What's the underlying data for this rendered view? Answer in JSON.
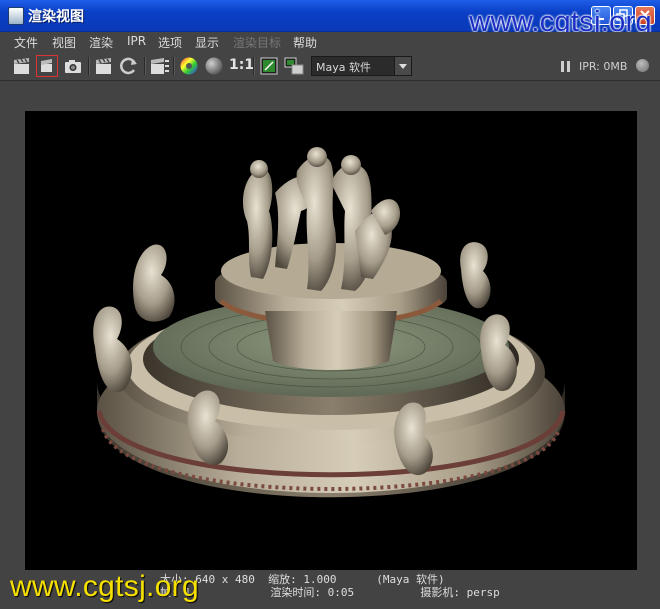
{
  "window": {
    "title": "渲染视图"
  },
  "watermark": "www.cgtsj.org",
  "menus": [
    {
      "label": "文件",
      "disabled": false
    },
    {
      "label": "视图",
      "disabled": false
    },
    {
      "label": "渲染",
      "disabled": false
    },
    {
      "label": "IPR",
      "disabled": false
    },
    {
      "label": "选项",
      "disabled": false
    },
    {
      "label": "显示",
      "disabled": false
    },
    {
      "label": "渲染目标",
      "disabled": true
    },
    {
      "label": "帮助",
      "disabled": false
    }
  ],
  "toolbar": {
    "ratio_label": "1:1",
    "renderer_selected": "Maya 软件",
    "ipr_status": "IPR: 0MB"
  },
  "status": {
    "line1_size": "大小: 640 x 480",
    "line1_zoom": "缩放: 1.000",
    "line1_renderer": "(Maya 软件)",
    "line2_frame": "帧: 1",
    "line2_time": "渲染时间: 0:05",
    "line2_camera": "摄影机: persp"
  }
}
